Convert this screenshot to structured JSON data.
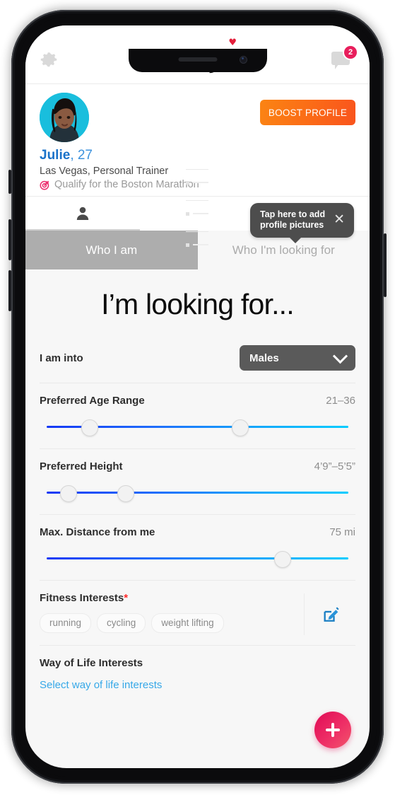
{
  "header": {
    "settings_icon": "gear-icon",
    "brand": "datefit",
    "messages_icon": "message-icon",
    "messages_badge": "2"
  },
  "profile": {
    "avatar_alt": "profile-photo",
    "boost_label": "BOOST PROFILE",
    "first_name": "Julie",
    "age": ", 27",
    "meta": "Las Vegas, Personal Trainer",
    "goal_icon": "target-icon",
    "goal": "Qualify for the Boston Marathon"
  },
  "icon_tabs": [
    {
      "name": "person-icon",
      "label": ""
    },
    {
      "name": "list-icon",
      "label": ""
    },
    {
      "name": "grid-icon",
      "label": ""
    }
  ],
  "tooltip": {
    "text": "Tap here to add\nprofile pictures",
    "close_icon": "close-icon"
  },
  "tabs": {
    "who_i_am": "Who I am",
    "who_im_looking_for": "Who I'm looking for"
  },
  "headline": "I’m looking for...",
  "fields": {
    "into_label": "I am into",
    "into_value": "Males",
    "age_label": "Preferred Age Range",
    "age_value": "21–36",
    "height_label": "Preferred Height",
    "height_value": "4’9”–5’5”",
    "distance_label": "Max. Distance from me",
    "distance_value": "75 mi",
    "fitness_label": "Fitness Interests",
    "fitness_required": "*",
    "fitness_chips": [
      "running",
      "cycling",
      "weight lifting"
    ],
    "edit_icon": "edit-pencil-icon",
    "life_label": "Way of Life Interests",
    "life_link": "Select way of life interests"
  },
  "fab": {
    "icon": "plus-icon"
  },
  "colors": {
    "brand_dark": "#111111",
    "accent_blue": "#1a72c9",
    "link_blue": "#36a8e8",
    "boost_orange": "#fb6a17",
    "badge_pink": "#e81e5c",
    "fab_pink": "#e00a55",
    "slider_start": "#1538f5",
    "slider_end": "#00ccff",
    "tab_active_bg": "#adadad",
    "select_bg": "#5a5a5a",
    "tooltip_bg": "#4d4d4d",
    "required_red": "#ff2b2b"
  },
  "slider_positions": {
    "age": [
      14,
      64
    ],
    "height": [
      7,
      26
    ],
    "distance": [
      78
    ]
  }
}
